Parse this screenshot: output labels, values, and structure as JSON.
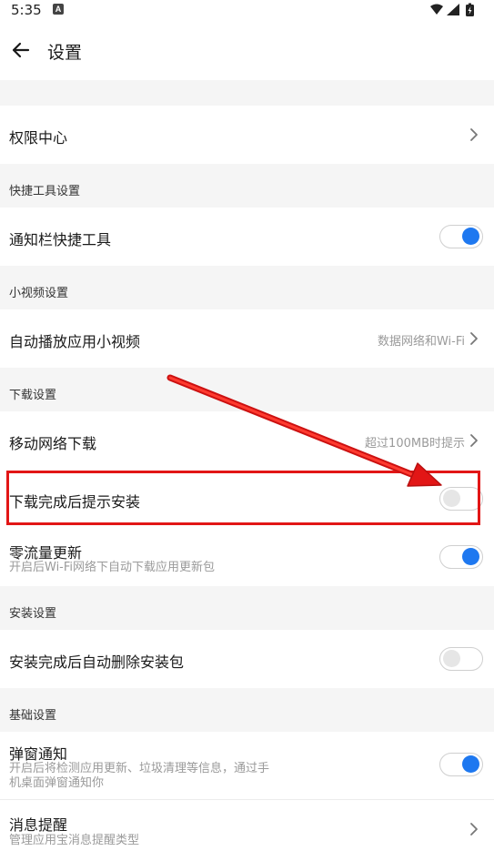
{
  "status_bar": {
    "time": "5:35",
    "notif_icon": "A"
  },
  "header": {
    "title": "设置",
    "back_icon": "arrow-left-icon"
  },
  "permissions": {
    "label": "权限中心"
  },
  "shortcut_section": {
    "header": "快捷工具设置",
    "notify_bar_label": "通知栏快捷工具",
    "notify_bar_on": true
  },
  "video_section": {
    "header": "小视频设置",
    "autoplay_label": "自动播放应用小视频",
    "autoplay_value": "数据网络和Wi-Fi"
  },
  "download_section": {
    "header": "下载设置",
    "mobile_label": "移动网络下载",
    "mobile_value": "超过100MB时提示",
    "prompt_install_label": "下载完成后提示安装",
    "prompt_install_on": false,
    "zero_traffic_label": "零流量更新",
    "zero_traffic_sub": "开启后Wi-Fi网络下自动下载应用更新包",
    "zero_traffic_on": true
  },
  "install_section": {
    "header": "安装设置",
    "auto_delete_label": "安装完成后自动删除安装包",
    "auto_delete_on": false
  },
  "basic_section": {
    "header": "基础设置",
    "popup_label": "弹窗通知",
    "popup_sub_line1": "开启后将检测应用更新、垃圾清理等信息，通过手",
    "popup_sub_line2": "机桌面弹窗通知你",
    "popup_on": true,
    "message_label": "消息提醒",
    "message_sub": "管理应用宝消息提醒类型"
  },
  "colors": {
    "accent": "#1e78f0",
    "annotation": "#e21616"
  }
}
